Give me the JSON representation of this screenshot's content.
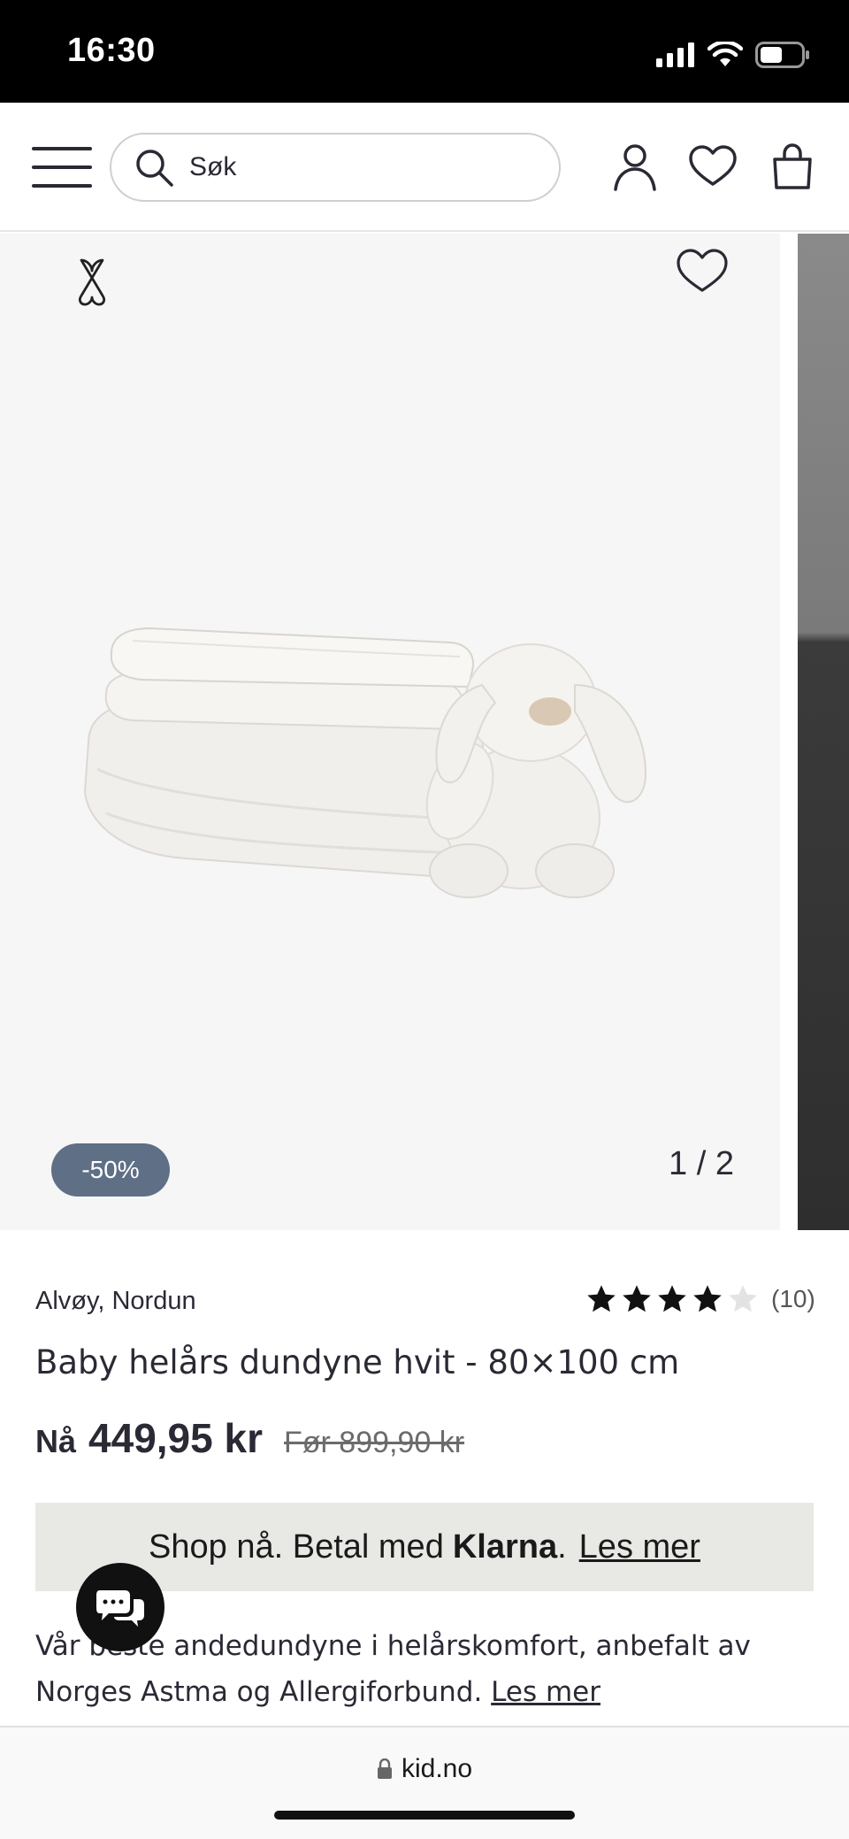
{
  "status_bar": {
    "time": "16:30",
    "icons": [
      "signal-icon",
      "wifi-icon",
      "battery-icon"
    ]
  },
  "header": {
    "search": {
      "placeholder": "Søk"
    },
    "icons": [
      "menu-icon",
      "search-icon",
      "account-icon",
      "wishlist-icon",
      "cart-icon"
    ]
  },
  "gallery": {
    "discount_badge": "-50%",
    "counter": "1 / 2",
    "icons": [
      "compare-icon",
      "favorite-icon"
    ]
  },
  "product": {
    "brand": "Alvøy, Nordun",
    "rating": {
      "stars": 4,
      "max": 5,
      "count": "(10)"
    },
    "title": "Baby helårs dundyne hvit - 80×100 cm",
    "price_now_label": "Nå",
    "price_now": "449,95 kr",
    "price_before": "Før 899,90 kr"
  },
  "klarna": {
    "text": "Shop nå. Betal med",
    "brand": "Klarna",
    "punct": ".",
    "link": "Les mer"
  },
  "description": {
    "text": "Vår beste andedundyne i helårskomfort, anbefalt av Norges Astma og Allergiforbund.",
    "link": "Les mer"
  },
  "browser": {
    "url": "kid.no"
  },
  "colors": {
    "badge": "#5e6f86",
    "text": "#2a2a35",
    "klarna_bg": "#e8e8e5"
  }
}
